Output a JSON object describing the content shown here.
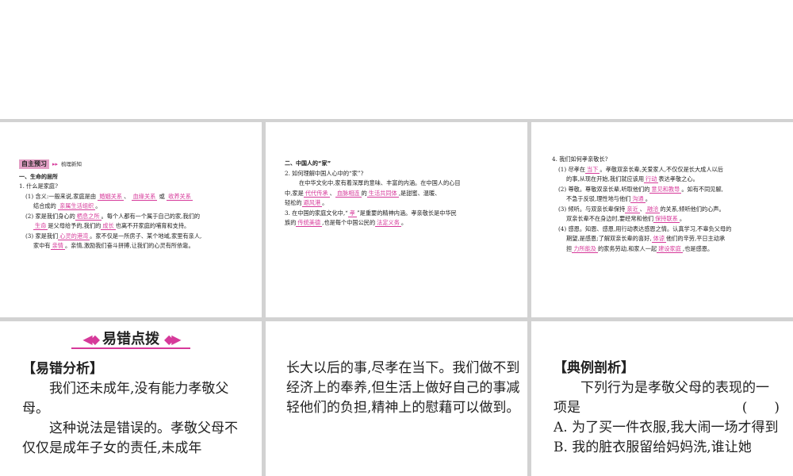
{
  "p1": {
    "tag": "自主预习",
    "tag_note": "梳理新知",
    "section1": "一、生命的居所",
    "q1": "1. 什么是家庭?",
    "l1_pre": "(1) 含义:一般来说,家庭是由",
    "a1": "婚姻关系",
    "a2": "血缘关系",
    "l1_or": "或",
    "a3": "收养关系",
    "l2_pre": "结合成的",
    "a4": "亲属生活组织",
    "l2_post": "。",
    "l3_pre": "(2) 家是我们身心的",
    "a5": "栖息之所",
    "l3_post": "。每个人都有一个属于自己的家,我们的",
    "a6": "生命",
    "l4_mid": "是父母给予的,我们的",
    "a7": "成长",
    "l4_post": "也离不开家庭的哺育和支持。",
    "l5_pre": "(3) 家是我们",
    "a8": "心灵的港湾",
    "l5_post": "。家不仅是一所房子、某个地域,家里有亲人,",
    "l6_pre": "家中有",
    "a9": "亲情",
    "l6_post": "。亲情,激励我们奋斗拼搏,让我们的心灵有所依靠。"
  },
  "p2": {
    "section": "二、中国人的“家”",
    "q2": "2. 如何理解中国人心中的“家”?",
    "l1": "在中华文化中,家有着深厚的意味、丰富的内涵。在中国人的心目",
    "l2_pre": "中,家是",
    "a1": "代代传承",
    "a2": "血脉相连",
    "l2_mid": "的",
    "a3": "生活共同体",
    "l2_post": ",是甜蜜、温暖、",
    "l3_pre": "轻松的",
    "a4": "避风港",
    "l3_post": "。",
    "q3_pre": "3. 在中国的家庭文化中,“",
    "a5": "孝",
    "q3_post": "”是重要的精神内涵。孝亲敬长是中华民",
    "l4_pre": "族的",
    "a6": "传统美德",
    "l4_mid": ",也是每个中国公民的",
    "a7": "法定义务",
    "l4_post": "。"
  },
  "p3": {
    "q4": "4. 我们如何孝亲敬长?",
    "l1_pre": "(1) 尽孝在",
    "a1": "当下",
    "l1_post": "。孝敬双亲长辈,关爱家人,不仅仅是长大成人以后",
    "l2_pre": "的事,从现在开始,我们就应该用",
    "a2": "行动",
    "l2_post": "表达孝敬之心。",
    "l3_pre": "(2) 尊敬。尊敬双亲长辈,听取他们的",
    "a3": "意见和教导",
    "l3_post": "。如有不同见解,",
    "l4_pre": "不急于反驳,理性地与他们",
    "a4": "沟通",
    "l4_post": "。",
    "l5_pre": "(3) 倾听。与双亲长辈保持",
    "a5": "亲近",
    "a6": "融洽",
    "l5_post": "的关系,倾听他们的心声。",
    "l6_pre": "双亲长辈不在身边时,要经常和他们",
    "a7": "保持联系",
    "l6_post": "。",
    "l7": "(4) 感恩。知恩、感恩,用行动表达感恩之情。认真学习,不辜负父母的",
    "l8_pre": "期望,是感恩;了解双亲长辈的喜好,",
    "a8": "体谅",
    "l8_post": "他们的辛劳,平日主动承",
    "l9_pre": "担",
    "a9": "力所能及",
    "l9_mid": "的家务劳动,和家人一起",
    "a10": "建设家庭",
    "l9_post": ",也是感恩。"
  },
  "p4": {
    "ribbon": "易错点拨",
    "heading": "【易错分析】",
    "para1": "我们还未成年,没有能力孝敬父母。",
    "para2": "这种说法是错误的。孝敬父母不仅仅是成年子女的责任,未成年"
  },
  "p5": {
    "text": "长大以后的事,尽孝在当下。我们做不到经济上的奉养,但生活上做好自己的事减轻他们的负担,精神上的慰藉可以做到。"
  },
  "p6": {
    "heading": "【典例剖析】",
    "question": "下列行为是孝敬父母的表现的一项是",
    "paren": "(　　)",
    "optA": "A. 为了买一件衣服,我大闹一场才得到",
    "optB": "B. 我的脏衣服留给妈妈洗,谁让她"
  }
}
